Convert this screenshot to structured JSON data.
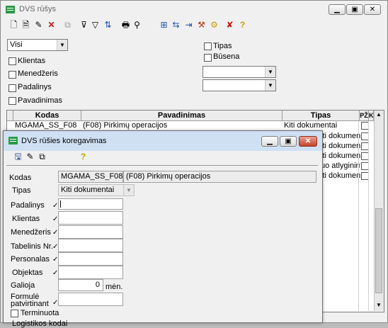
{
  "main_window": {
    "title": "DVS rūšys",
    "filter": {
      "scope_value": "Visi",
      "left_checks": [
        "Klientas",
        "Menedžeris",
        "Padalinys",
        "Pavadinimas"
      ],
      "right_checks": [
        "Tipas",
        "Būsena"
      ]
    },
    "grid": {
      "columns": [
        "Kodas",
        "Pavadinimas",
        "Tipas",
        "PŽ",
        "K"
      ],
      "first_row": {
        "kodas": "MGAMA_SS_F08",
        "pavadinimas": "(F08) Pirkimų operacijos",
        "tipas": "Kiti dokumentai"
      },
      "partial_tipas": [
        "iti dokumentai",
        "iti dokumentai",
        "iti dokumentai",
        "uo atlyginimų algoms",
        "iti dokumentai"
      ]
    }
  },
  "dialog": {
    "title": "DVS rūšies koregavimas",
    "kodas_label": "Kodas",
    "kodas_value": "MGAMA_SS_F08",
    "pavadinimas_value": "(F08) Pirkimų operacijos",
    "tipas_label": "Tipas",
    "tipas_value": "Kiti dokumentai",
    "fields": [
      "Padalinys",
      "Klientas",
      "Menedžeris",
      "Tabelinis Nr.",
      "Personalas",
      "Objektas"
    ],
    "galioja_label": "Galioja",
    "galioja_value": "0",
    "galioja_unit": "mėn.",
    "formule_label_1": "Formulė",
    "formule_label_2": "patvirtinant",
    "terminuota_label": "Terminuota",
    "cut_label": "Logistikos kodai"
  },
  "icons": {
    "toolbar": [
      "new-doc-icon",
      "edit-doc-icon",
      "copy-edit-icon",
      "delete-icon",
      "duplicate-icon",
      "filter-clear-icon",
      "filter-icon",
      "sort-icon",
      "print-icon",
      "find-icon",
      "tree-icon",
      "link-icon",
      "export-icon",
      "tools-icon",
      "folder-icon",
      "cancel-icon",
      "help-icon"
    ],
    "dialog_toolbar": [
      "save-icon",
      "undo-icon",
      "copy-icon",
      "help-icon"
    ]
  },
  "colors": {
    "title_icon": "#2a9a45",
    "close": "#c4422a",
    "delete": "#cc1010"
  }
}
